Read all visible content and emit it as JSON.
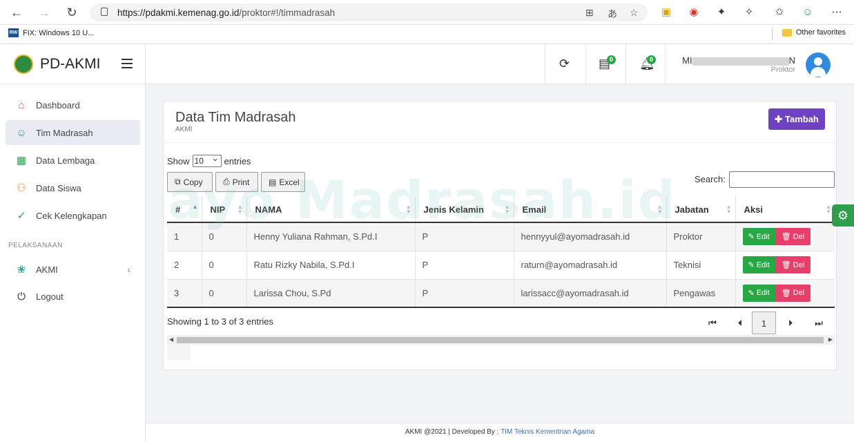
{
  "browser": {
    "url_host": "https://pdakmi.kemenag.go.id",
    "url_path": "/proktor#!/timmadrasah",
    "bookmark_label": "FIX: Windows 10 U...",
    "bookmark_favicon_text": "RW",
    "other_favorites": "Other favorites"
  },
  "app": {
    "title": "PD-AKMI",
    "notif_messages": "0",
    "notif_bell": "0",
    "user_name_visible": "MI",
    "user_name_tail": "N",
    "user_role": "Proktor"
  },
  "sidebar": {
    "items": [
      {
        "label": "Dashboard",
        "icon": "home-icon"
      },
      {
        "label": "Tim Madrasah",
        "icon": "user-icon"
      },
      {
        "label": "Data Lembaga",
        "icon": "document-icon"
      },
      {
        "label": "Data Siswa",
        "icon": "users-icon"
      },
      {
        "label": "Cek Kelengkapan",
        "icon": "user-check-icon"
      }
    ],
    "section_label": "PELAKSANAAN",
    "section_items": [
      {
        "label": "AKMI",
        "icon": "lotus-icon"
      },
      {
        "label": "Logout",
        "icon": "power-icon"
      }
    ]
  },
  "page": {
    "title": "Data Tim Madrasah",
    "subtitle": "AKMI",
    "add_button": "Tambah",
    "show_label": "Show",
    "entries_select": "10",
    "entries_label": "entries",
    "copy_button": "Copy",
    "print_button": "Print",
    "excel_button": "Excel",
    "search_label": "Search:",
    "search_value": "",
    "columns": [
      "#",
      "NIP",
      "NAMA",
      "Jenis Kelamin",
      "Email",
      "Jabatan",
      "Aksi"
    ],
    "rows": [
      {
        "no": "1",
        "nip": "0",
        "nama": "Henny Yuliana Rahman, S.Pd.I",
        "jk": "P",
        "email": "hennyyul@ayomadrasah.id",
        "jabatan": "Proktor"
      },
      {
        "no": "2",
        "nip": "0",
        "nama": "Ratu Rizky Nabila, S.Pd.I",
        "jk": "P",
        "email": "raturn@ayomadrasah.id",
        "jabatan": "Teknisi"
      },
      {
        "no": "3",
        "nip": "0",
        "nama": "Larissa Chou, S.Pd",
        "jk": "P",
        "email": "larissacc@ayomadrasah.id",
        "jabatan": "Pengawas"
      }
    ],
    "edit_label": "Edit",
    "del_label": "Del",
    "showing_text": "Showing 1 to 3 of 3 entries",
    "current_page": "1",
    "watermark": "ayo Madrasah.id"
  },
  "footer": {
    "prefix": "AKMI @2021 | Developed By : ",
    "link": "TIM Teknis Kementrian Agama"
  },
  "colors": {
    "accent_purple": "#6f42c1",
    "edit_green": "#28a745",
    "del_pink": "#e83e6c",
    "avatar_blue": "#2f8ae0"
  }
}
